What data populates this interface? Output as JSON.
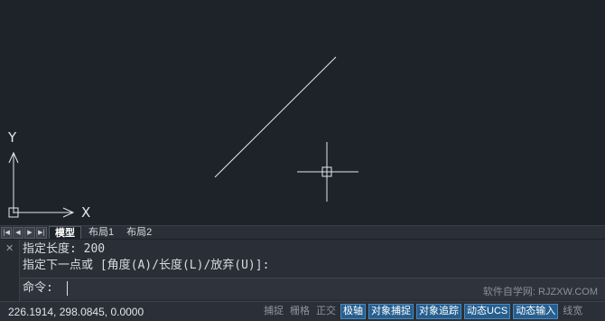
{
  "canvas": {
    "axis_x_label": "X",
    "axis_y_label": "Y",
    "line_color": "#e6e6e6",
    "background": "#1e2229"
  },
  "tabbar": {
    "nav_buttons": [
      "first",
      "prev",
      "next",
      "last"
    ],
    "tabs": [
      {
        "label": "模型",
        "active": true
      },
      {
        "label": "布局1",
        "active": false
      },
      {
        "label": "布局2",
        "active": false
      }
    ]
  },
  "command": {
    "history": [
      "指定长度: 200",
      "指定下一点或 [角度(A)/长度(L)/放弃(U)]:"
    ],
    "prompt": "命令:",
    "close_icon": "close-icon",
    "watermark": "软件自学网: RJZXW.COM"
  },
  "status": {
    "coordinates": "226.1914, 298.0845, 0.0000",
    "toggles": [
      {
        "label": "捕捉",
        "on": false
      },
      {
        "label": "栅格",
        "on": false
      },
      {
        "label": "正交",
        "on": false
      },
      {
        "label": "极轴",
        "on": true
      },
      {
        "label": "对象捕捉",
        "on": true
      },
      {
        "label": "对象追踪",
        "on": true
      },
      {
        "label": "动态UCS",
        "on": true
      },
      {
        "label": "动态输入",
        "on": true
      },
      {
        "label": "线宽",
        "on": false
      }
    ],
    "accent_color": "#265f8f"
  }
}
